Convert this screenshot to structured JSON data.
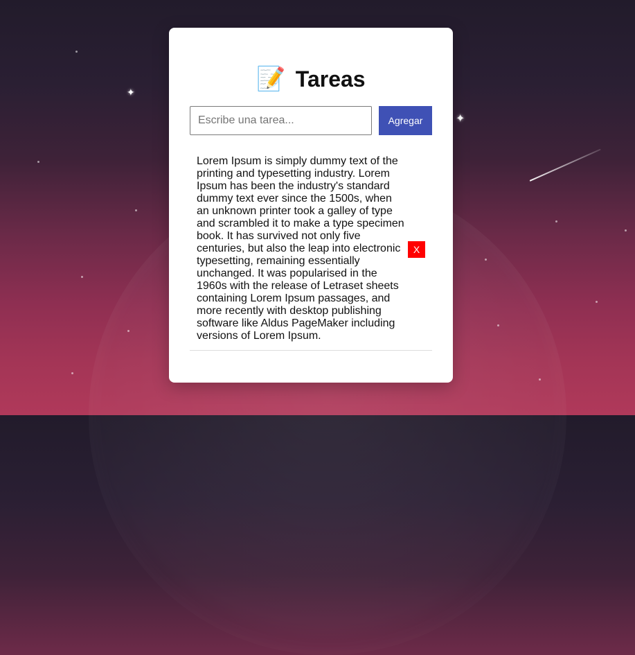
{
  "app": {
    "title": "Tareas",
    "title_icon": "memo-icon"
  },
  "form": {
    "input_value": "",
    "input_placeholder": "Escribe una tarea...",
    "add_button_label": "Agregar"
  },
  "tasks": [
    {
      "text": "Lorem Ipsum is simply dummy text of the printing and typesetting industry. Lorem Ipsum has been the industry's standard dummy text ever since the 1500s, when an unknown printer took a galley of type and scrambled it to make a type specimen book. It has survived not only five centuries, but also the leap into electronic typesetting, remaining essentially unchanged. It was popularised in the 1960s with the release of Letraset sheets containing Lorem Ipsum passages, and more recently with desktop publishing software like Aldus PageMaker including versions of Lorem Ipsum.",
      "delete_label": "X"
    }
  ],
  "colors": {
    "accent": "#3f51b5",
    "delete": "#ff0000",
    "card": "#ffffff"
  }
}
